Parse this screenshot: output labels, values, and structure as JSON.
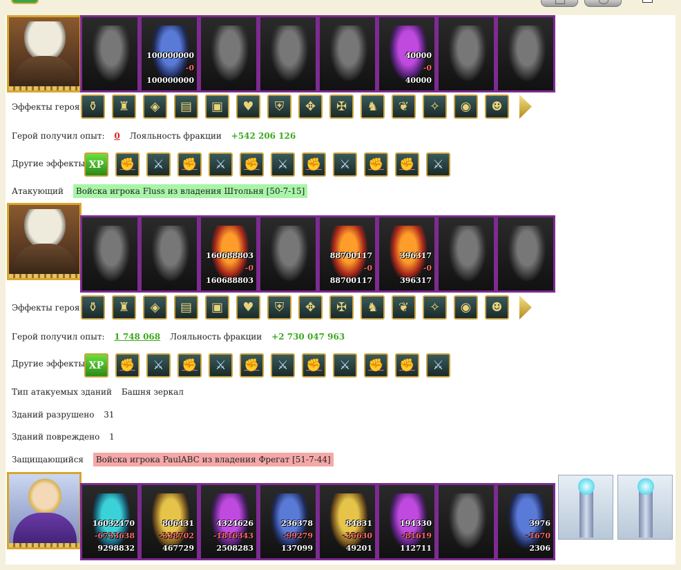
{
  "labels": {
    "hero_effects": "Эффекты героя:",
    "exp": "Герой получил опыт:",
    "loyalty": "Лояльность фракции",
    "other_effects": "Другие эффекты:",
    "attacking": "Атакующий",
    "defending": "Защищающийся",
    "building_type": "Тип атакуемых зданий",
    "destroyed": "Зданий разрушено",
    "damaged": "Зданий повреждено"
  },
  "section1": {
    "exp_value": "0",
    "loyalty_value": "+542 206 126",
    "troops": [
      {
        "color": "gray",
        "n1": "",
        "n2": "",
        "n3": ""
      },
      {
        "color": "blue",
        "n1": "100000000",
        "n2": "-0",
        "n3": "100000000"
      },
      {
        "color": "gray",
        "n1": "",
        "n2": "",
        "n3": ""
      },
      {
        "color": "gray",
        "n1": "",
        "n2": "",
        "n3": ""
      },
      {
        "color": "gray",
        "n1": "",
        "n2": "",
        "n3": ""
      },
      {
        "color": "purple",
        "n1": "40000",
        "n2": "-0",
        "n3": "40000"
      },
      {
        "color": "gray",
        "n1": "",
        "n2": "",
        "n3": ""
      },
      {
        "color": "gray",
        "n1": "",
        "n2": "",
        "n3": ""
      }
    ]
  },
  "attacker": {
    "text": "Войска игрока Fluss из владения Штольня [50-7-15]",
    "exp_value": "1 748 068",
    "loyalty_value": "+2 730 047 963",
    "troops": [
      {
        "color": "gray",
        "n1": "",
        "n2": "",
        "n3": ""
      },
      {
        "color": "gray",
        "n1": "",
        "n2": "",
        "n3": ""
      },
      {
        "color": "fire",
        "n1": "160688803",
        "n2": "-0",
        "n3": "160688803"
      },
      {
        "color": "gray",
        "n1": "",
        "n2": "",
        "n3": ""
      },
      {
        "color": "fire",
        "n1": "88700117",
        "n2": "-0",
        "n3": "88700117"
      },
      {
        "color": "fire",
        "n1": "396317",
        "n2": "-0",
        "n3": "396317"
      },
      {
        "color": "gray",
        "n1": "",
        "n2": "",
        "n3": ""
      },
      {
        "color": "gray",
        "n1": "",
        "n2": "",
        "n3": ""
      }
    ]
  },
  "buildings": {
    "type": "Башня зеркал",
    "destroyed": "31",
    "damaged": "1"
  },
  "defender": {
    "text": "Войска игрока PaulABC из владения Фрегат [51-7-44]",
    "troops": [
      {
        "color": "teal",
        "n1": "16032470",
        "n2": "-6733638",
        "n3": "9298832"
      },
      {
        "color": "gold",
        "n1": "806431",
        "n2": "-338702",
        "n3": "467729"
      },
      {
        "color": "purple",
        "n1": "4324626",
        "n2": "-1816343",
        "n3": "2508283"
      },
      {
        "color": "blue",
        "n1": "236378",
        "n2": "-99279",
        "n3": "137099"
      },
      {
        "color": "gold",
        "n1": "84831",
        "n2": "-35630",
        "n3": "49201"
      },
      {
        "color": "purple",
        "n1": "194330",
        "n2": "-81619",
        "n3": "112711"
      },
      {
        "color": "gray",
        "n1": "",
        "n2": "",
        "n3": ""
      },
      {
        "color": "blue",
        "n1": "3976",
        "n2": "-1670",
        "n3": "2306"
      }
    ]
  },
  "icons": {
    "hero_effects": [
      "bag-icon",
      "helm-icon",
      "chest-icon",
      "book-icon",
      "treasure-icon",
      "heart-icon",
      "shield-icon",
      "rune-icon",
      "cross-icon",
      "horse-icon",
      "wings-icon",
      "claw-icon",
      "orb-icon",
      "mask-icon"
    ],
    "other_effects": [
      "xp-icon",
      "fist-icon",
      "sword-icon",
      "fist-icon",
      "sword-icon",
      "fist-icon",
      "sword-icon",
      "fist-icon",
      "sword-icon",
      "fist-icon",
      "fist-icon",
      "sword-icon"
    ],
    "xp_text": "XP"
  }
}
